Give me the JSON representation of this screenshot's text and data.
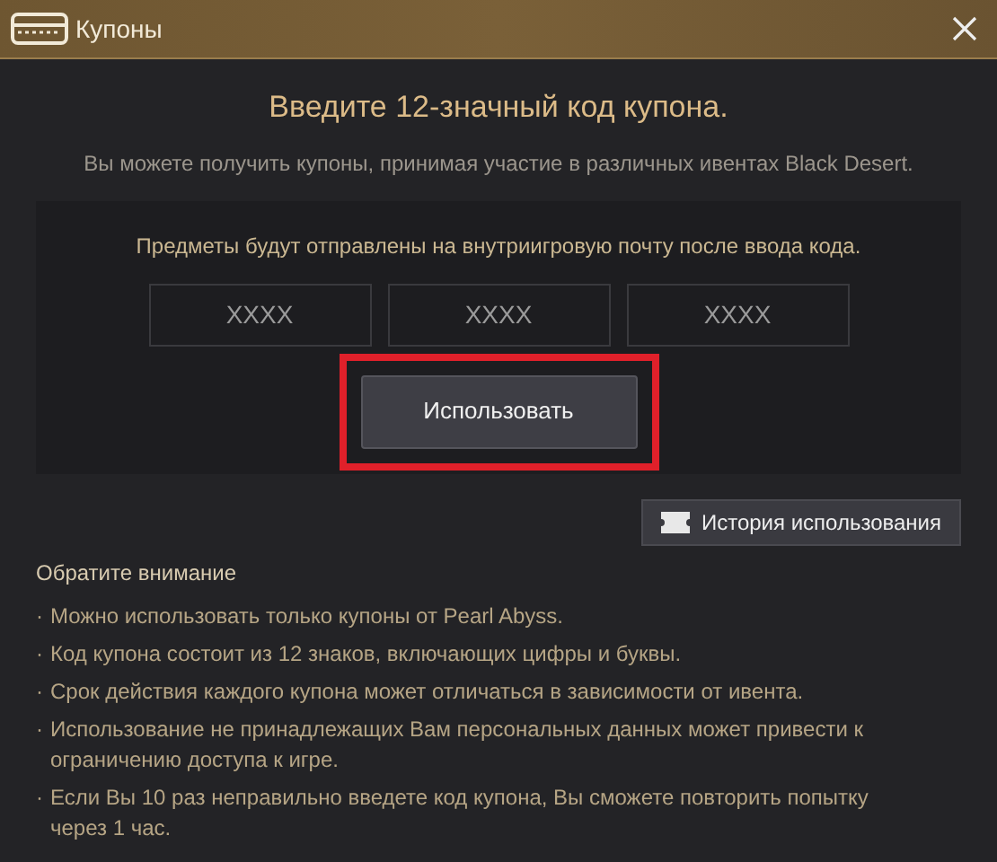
{
  "window": {
    "title": "Купоны"
  },
  "heading": "Введите 12-значный код купона.",
  "subheading": "Вы можете получить купоны, принимая участие в различных ивентах Black Desert.",
  "panel": {
    "info": "Предметы будут отправлены на внутриигровую почту после ввода кода.",
    "code_fields": [
      {
        "placeholder": "XXXX"
      },
      {
        "placeholder": "XXXX"
      },
      {
        "placeholder": "XXXX"
      }
    ],
    "use_button": {
      "label": "Использовать",
      "highlighted": true
    }
  },
  "history_button": {
    "label": "История использования"
  },
  "notes": {
    "title": "Обратите внимание",
    "bullet": "·",
    "items": [
      "Можно использовать только купоны от Pearl Abyss.",
      "Код купона состоит из 12 знаков, включающих цифры и буквы.",
      "Срок действия каждого купона может отличаться в зависимости от ивента.",
      "Использование не принадлежащих Вам персональных данных может привести к ограничению доступа к игре.",
      "Если Вы 10 раз неправильно введете код купона, Вы сможете повторить попытку через 1 час."
    ]
  }
}
